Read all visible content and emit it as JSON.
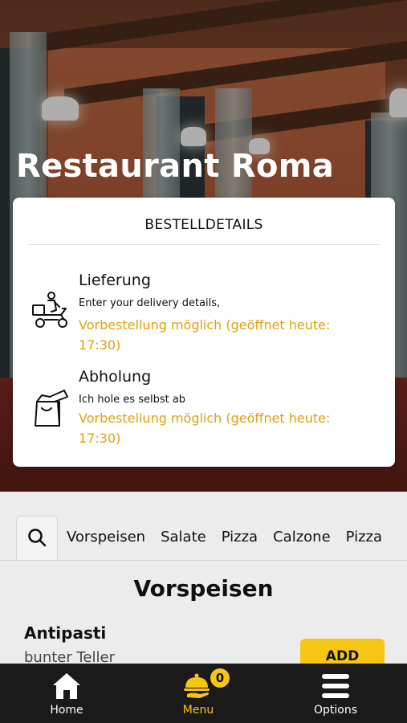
{
  "restaurant": {
    "name": "Restaurant Roma"
  },
  "order_details": {
    "title": "BESTELLDETAILS",
    "delivery": {
      "title": "Lieferung",
      "subtitle": "Enter your delivery details,",
      "note": "Vorbestellung möglich (geöffnet heute: 17:30)",
      "icon": "delivery-scooter-icon"
    },
    "pickup": {
      "title": "Abholung",
      "subtitle": "Ich hole es selbst ab",
      "note": "Vorbestellung möglich (geöffnet heute: 17:30)",
      "icon": "takeaway-bag-icon"
    }
  },
  "categories": [
    "Vorspeisen",
    "Salate",
    "Pizza",
    "Calzone",
    "Pizza"
  ],
  "menu_section": {
    "title": "Vorspeisen",
    "items": [
      {
        "name": "Antipasti",
        "description": "bunter Teller",
        "add_label": "ADD"
      }
    ]
  },
  "bottom_nav": {
    "home": {
      "label": "Home",
      "icon": "home-icon"
    },
    "menu": {
      "label": "Menu",
      "icon": "cloche-icon",
      "cart_count": "0"
    },
    "options": {
      "label": "Options",
      "icon": "hamburger-menu-icon"
    }
  },
  "colors": {
    "accent": "#f7c614",
    "note": "#e3a00f",
    "nav_bg": "#1a1a1a"
  }
}
